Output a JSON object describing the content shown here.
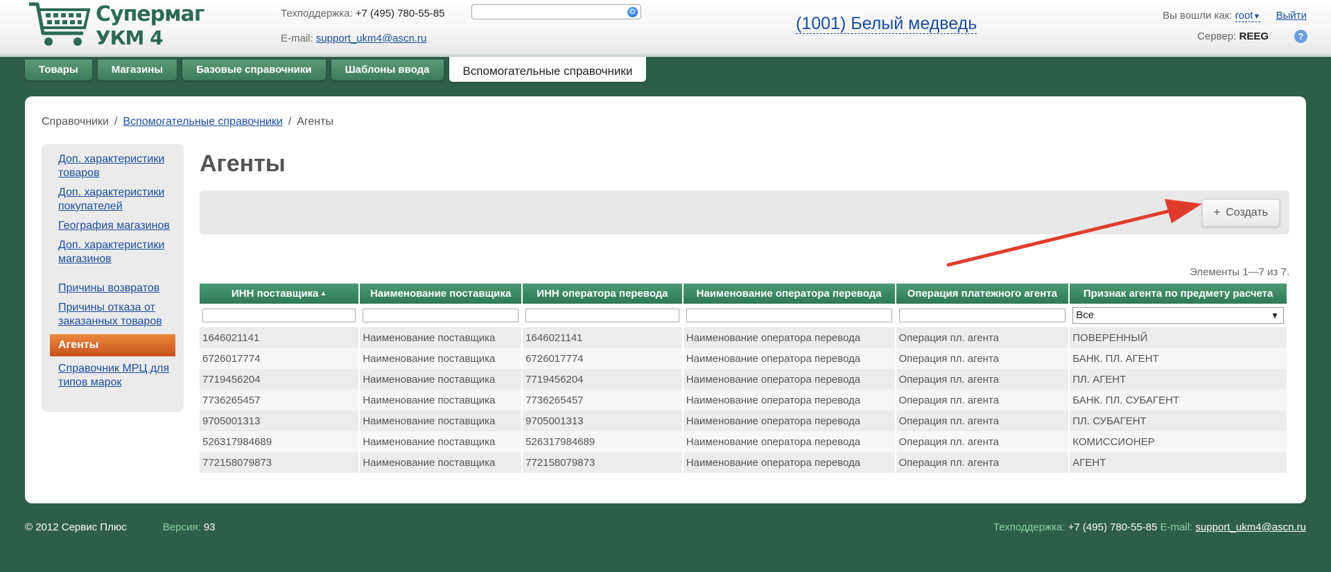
{
  "header": {
    "logo_line1": "Супермаг",
    "logo_line2": "УКМ 4",
    "support_label": "Техподдержка:",
    "support_phone": "+7 (495) 780-55-85",
    "email_label": "E-mail:",
    "email": "support_ukm4@ascn.ru",
    "search_value": "",
    "store": "(1001) Белый медведь",
    "logged_label": "Вы вошли как:",
    "user": "root",
    "logout": "Выйти",
    "server_label": "Сервер:",
    "server": "REEG",
    "help": "?"
  },
  "tabs": [
    {
      "label": "Товары"
    },
    {
      "label": "Магазины"
    },
    {
      "label": "Базовые справочники"
    },
    {
      "label": "Шаблоны ввода"
    },
    {
      "label": "Вспомогательные справочники"
    }
  ],
  "breadcrumb": {
    "root": "Справочники",
    "section": "Вспомогательные справочники",
    "current": "Агенты",
    "sep": "/"
  },
  "sidebar": {
    "items": [
      {
        "label": "Доп. характеристики товаров"
      },
      {
        "label": "Доп. характеристики покупателей"
      },
      {
        "label": "География магазинов"
      },
      {
        "label": "Доп. характеристики магазинов"
      },
      {
        "label": "Причины возвратов"
      },
      {
        "label": "Причины отказа от заказанных товаров"
      },
      {
        "label": "Агенты"
      },
      {
        "label": "Справочник МРЦ для типов марок"
      }
    ]
  },
  "page": {
    "title": "Агенты",
    "create_button": "Создать",
    "counter": "Элементы 1—7 из 7."
  },
  "table": {
    "columns": [
      "ИНН поставщика",
      "Наименование поставщика",
      "ИНН оператора перевода",
      "Наименование оператора перевода",
      "Операция платежного агента",
      "Признак агента по предмету расчета"
    ],
    "sort_indicator": "▲",
    "filter_select": "Все",
    "rows": [
      [
        "1646021141",
        "Наименование поставщика",
        "1646021141",
        "Наименование оператора перевода",
        "Операция пл. агента",
        "ПОВЕРЕННЫЙ"
      ],
      [
        "6726017774",
        "Наименование поставщика",
        "6726017774",
        "Наименование оператора перевода",
        "Операция пл. агента",
        "БАНК. ПЛ. АГЕНТ"
      ],
      [
        "7719456204",
        "Наименование поставщика",
        "7719456204",
        "Наименование оператора перевода",
        "Операция пл. агента",
        "ПЛ. АГЕНТ"
      ],
      [
        "7736265457",
        "Наименование поставщика",
        "7736265457",
        "Наименование оператора перевода",
        "Операция пл. агента",
        "БАНК. ПЛ. СУБАГЕНТ"
      ],
      [
        "9705001313",
        "Наименование поставщика",
        "9705001313",
        "Наименование оператора перевода",
        "Операция пл. агента",
        "ПЛ. СУБАГЕНТ"
      ],
      [
        "526317984689",
        "Наименование поставщика",
        "526317984689",
        "Наименование оператора перевода",
        "Операция пл. агента",
        "КОМИССИОНЕР"
      ],
      [
        "772158079873",
        "Наименование поставщика",
        "772158079873",
        "Наименование оператора перевода",
        "Операция пл. агента",
        "АГЕНТ"
      ]
    ]
  },
  "footer": {
    "copyright": "© 2012 Сервис Плюс",
    "version_label": "Версия:",
    "version": "93",
    "support_label": "Техподдержка:",
    "support_phone": "+7 (495) 780-55-85",
    "email_label": "E-mail:",
    "email": "support_ukm4@ascn.ru"
  },
  "colors": {
    "background": "#2d5e49",
    "accent_green": "#3c7a5c",
    "active_orange": "#d9652a",
    "link": "#1b4ea0",
    "arrow": "#e03c2c"
  }
}
